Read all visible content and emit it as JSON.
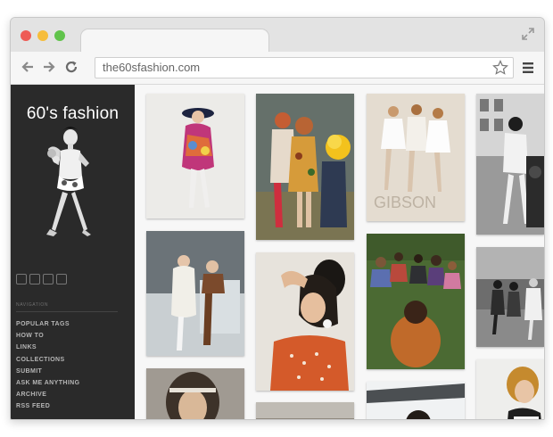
{
  "browser": {
    "url": "the60sfashion.com"
  },
  "site": {
    "title": "60's fashion",
    "social_icons": [
      "facebook-icon",
      "twitter-icon",
      "instagram-icon",
      "pinterest-icon"
    ],
    "nav_heading": "NAVIGATION",
    "nav_items": [
      "POPULAR TAGS",
      "HOW TO",
      "LINKS",
      "COLLECTIONS",
      "SUBMIT",
      "ASK ME ANYTHING",
      "ARCHIVE",
      "RSS FEED"
    ]
  },
  "gallery": {
    "photos": [
      "model-floral-dress-hat-photo",
      "festival-crowd-photo",
      "three-models-magazine-photo",
      "woman-mailbox-street-photo",
      "model-white-coat-ice-photo",
      "woman-orange-dress-portrait-photo",
      "group-on-grass-photo",
      "street-scene-photo",
      "woman-headband-portrait-photo",
      "snow-landscape-photo",
      "woman-bob-haircut-photo"
    ]
  },
  "colors": {
    "sidebar": "#2a2a2a",
    "traffic_red": "#ee5b55",
    "traffic_yellow": "#f6bd3b",
    "traffic_green": "#60c34b"
  }
}
